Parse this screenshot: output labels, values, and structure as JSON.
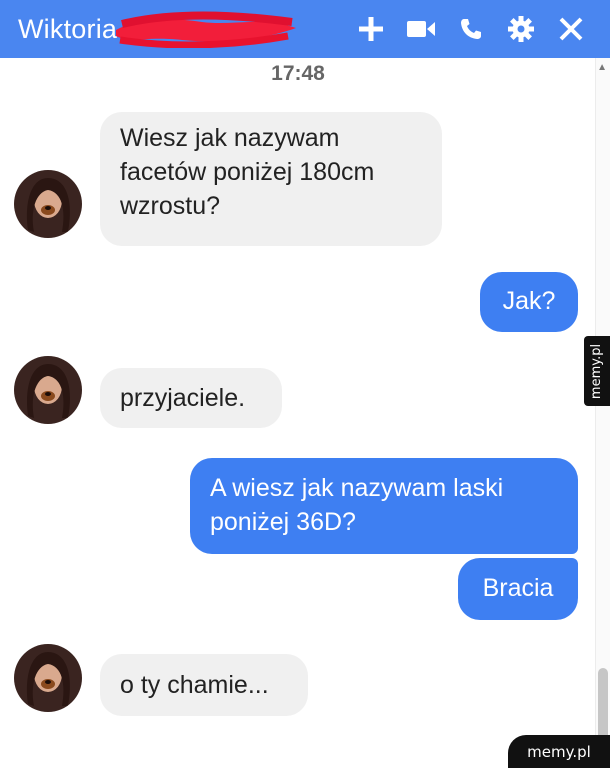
{
  "header": {
    "contact_name": "Wiktoria",
    "background_color": "#4a86f0",
    "icons": [
      "plus-icon",
      "video-camera-icon",
      "phone-icon",
      "gear-icon",
      "close-icon"
    ]
  },
  "conversation": {
    "timestamp": "17:48",
    "messages": [
      {
        "from": "contact",
        "text": "Wiesz jak nazywam facetów poniżej 180cm wzrostu?"
      },
      {
        "from": "me",
        "text": "Jak?"
      },
      {
        "from": "contact",
        "text": "przyjaciele."
      },
      {
        "from": "me",
        "text": "A wiesz jak nazywam laski poniżej 36D?"
      },
      {
        "from": "me",
        "text": "Bracia"
      },
      {
        "from": "contact",
        "text": "o ty chamie..."
      }
    ]
  },
  "watermarks": {
    "side": "memy.pl",
    "corner": "memy.pl"
  },
  "colors": {
    "outgoing_bubble": "#3e7ff2",
    "incoming_bubble": "#f0f0f0"
  }
}
